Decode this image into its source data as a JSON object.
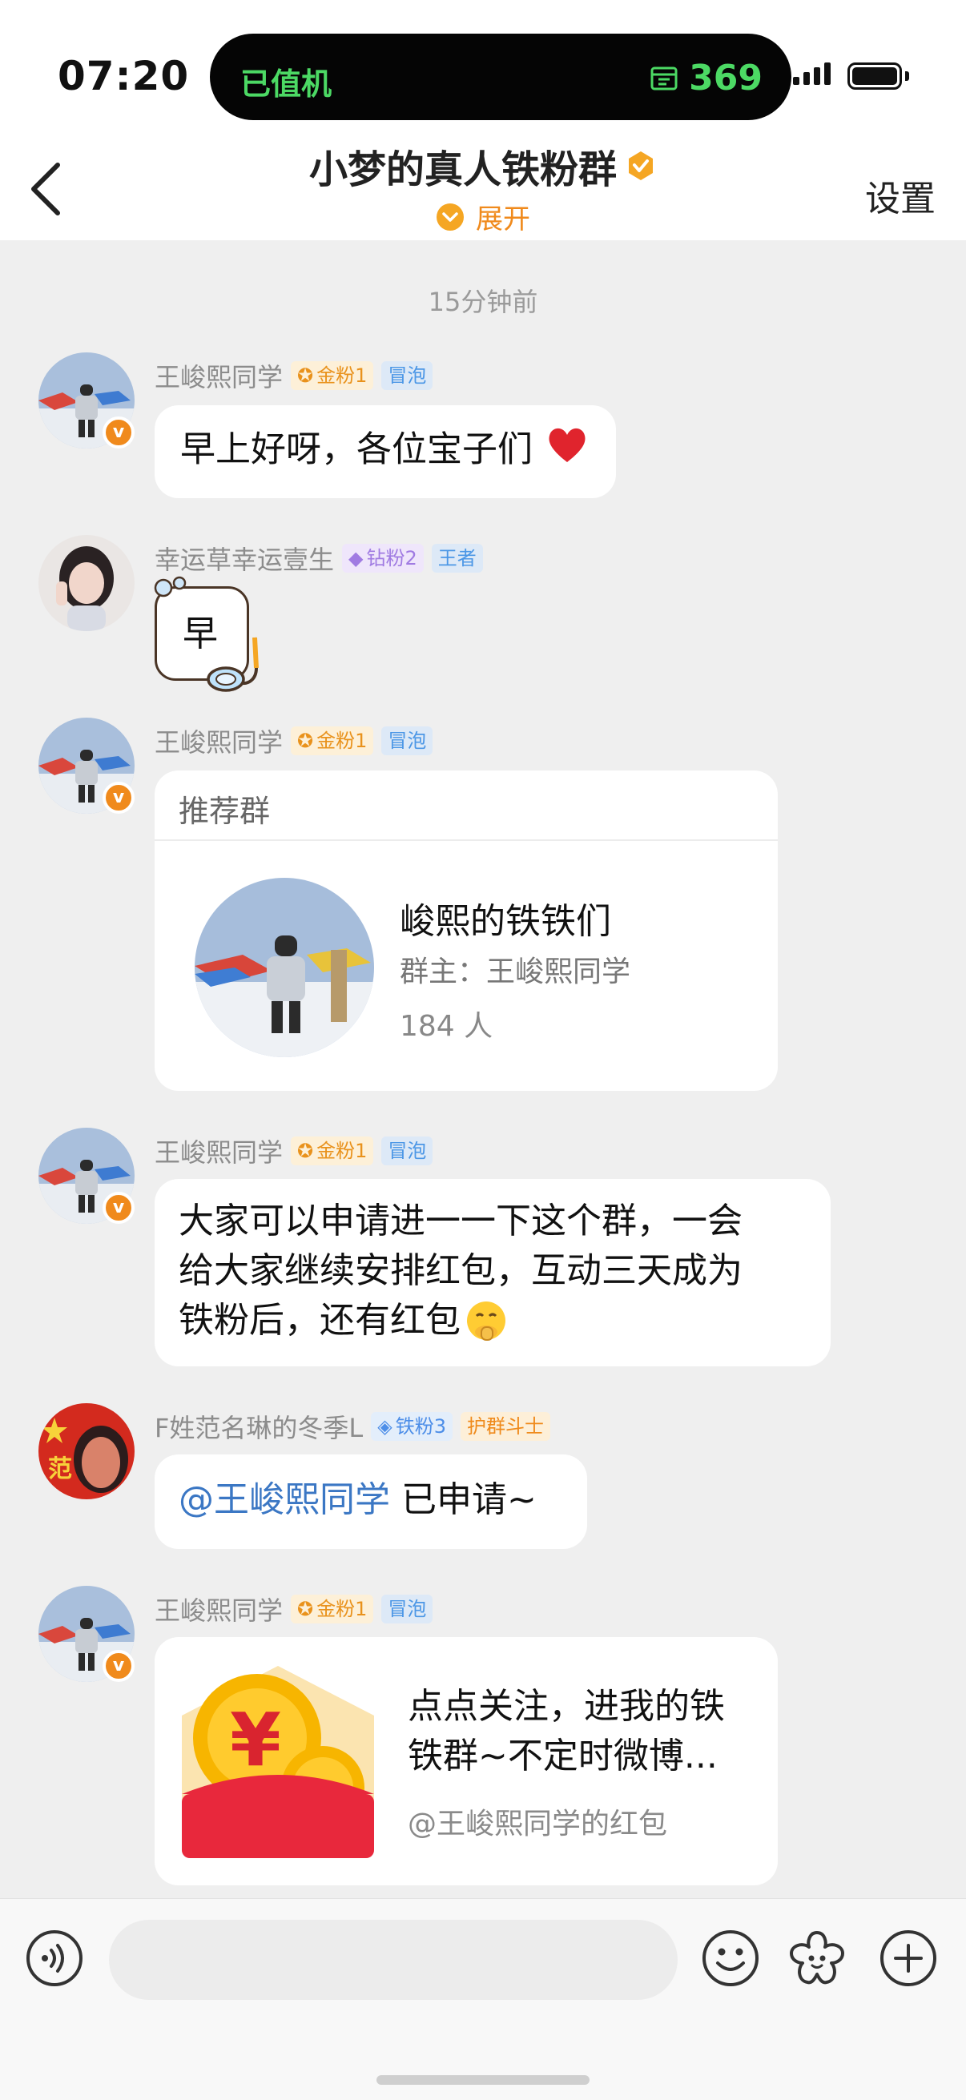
{
  "status_bar": {
    "time": "07:20",
    "island_left": "已值机",
    "island_right": "369",
    "island_icon": "flight-ticket-icon"
  },
  "nav": {
    "back_icon": "chevron-left-icon",
    "title": "小梦的真人铁粉群",
    "expand_label": "展开",
    "settings_label": "设置"
  },
  "chat": {
    "timestamp": "15分钟前",
    "messages": [
      {
        "sender": "王峻熙同学",
        "badge1": "金粉1",
        "badge2": "冒泡",
        "text": "早上好呀，各位宝子们",
        "emoji": "red-heart-icon"
      },
      {
        "sender": "幸运草幸运壹生",
        "badge1": "钻粉2",
        "badge2": "王者",
        "text": "早",
        "decoration": "snorkel-icon"
      },
      {
        "sender": "王峻熙同学",
        "badge1": "金粉1",
        "badge2": "冒泡",
        "card": {
          "header": "推荐群",
          "group_name": "峻熙的铁铁们",
          "owner": "群主：王峻熙同学",
          "members": "184 人"
        }
      },
      {
        "sender": "王峻熙同学",
        "badge1": "金粉1",
        "badge2": "冒泡",
        "line1": "大家可以申请进一一下这个群，一会",
        "line2": "给大家继续安排红包，互动三天成为",
        "line3": "铁粉后，还有红包",
        "emoji": "shushing-face-icon"
      },
      {
        "sender": "F姓范名琳的冬季L",
        "badge1": "铁粉3",
        "badge2": "护群斗士",
        "mention": "@王峻熙同学",
        "text": " 已申请~"
      },
      {
        "sender": "王峻熙同学",
        "badge1": "金粉1",
        "badge2": "冒泡",
        "redpacket": {
          "line1": "点点关注，进我的铁",
          "line2": "铁群~不定时微博...",
          "source": "@王峻熙同学的红包"
        }
      }
    ]
  },
  "input_bar": {
    "voice_icon": "voice-icon",
    "emoji_icon": "smiley-icon",
    "sticker_icon": "flower-sticker-icon",
    "plus_icon": "plus-icon"
  },
  "colors": {
    "accent_orange": "#f08a1c",
    "island_green": "#4cd964",
    "mention_blue": "#3b77c4",
    "chat_background": "#efefef",
    "redpacket_red": "#e8283c"
  }
}
